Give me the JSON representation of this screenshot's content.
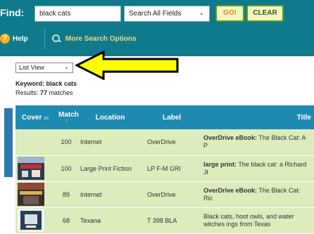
{
  "header": {
    "find_label": "Find:",
    "search_value": "black cats",
    "field_select": "Search All Fields",
    "go_label": "GO!",
    "clear_label": "CLEAR",
    "help_label": "Help",
    "more_options_label": "More Search Options"
  },
  "view_select": {
    "selected": "List View"
  },
  "summary": {
    "keyword_label": "Keyword:",
    "keyword_value": "black cats",
    "results_label": "Results:",
    "results_count": "77",
    "results_suffix": "matches"
  },
  "table": {
    "headers": {
      "cover": "Cover",
      "cover_sort": "as",
      "match": "Match",
      "match_sort": "↑",
      "location": "Location",
      "label": "Label",
      "title": "Title"
    },
    "rows": [
      {
        "cover": "",
        "match": "100",
        "location": "Internet",
        "label": "OverDrive",
        "title_prefix": "OverDrive eBook:",
        "title_text": " The Black Cat: A P"
      },
      {
        "cover": "book-cover",
        "match": "100",
        "location": "Large Print Fiction",
        "label": "LP F-M GRI",
        "title_prefix": "large print:",
        "title_text": " The black cat: a Richard Jt"
      },
      {
        "cover": "book-cover",
        "match": "89",
        "location": "Internet",
        "label": "OverDrive",
        "title_prefix": "OverDrive eBook:",
        "title_text": " The Black Cat: Ric"
      },
      {
        "cover": "book-cover",
        "match": "68",
        "location": "Texana",
        "label": "T 398 BLA",
        "title_prefix": "",
        "title_text": "Black cats, hoot owls, and water witches ings from Texas"
      }
    ]
  },
  "colors": {
    "header_bg": "#0f7a8c",
    "table_header_bg": "#1f8ab2",
    "row_bg": "#dcecbc",
    "arrow_fill": "#ffff00"
  }
}
